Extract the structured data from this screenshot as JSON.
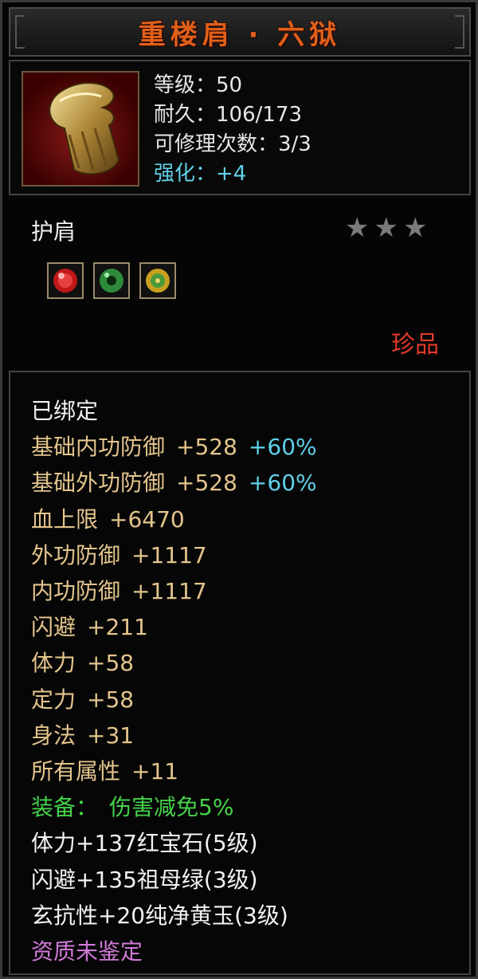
{
  "title": "重楼肩 · 六狱",
  "stats": {
    "level": "等级：50",
    "durability": "耐久：106/173",
    "repair": "可修理次数：3/3",
    "enhance": "强化：+4"
  },
  "item_type": "护肩",
  "star_count": 3,
  "gems": [
    "red-gem-icon",
    "green-jade-icon",
    "yellow-jade-icon"
  ],
  "rarity": "珍品",
  "attributes": {
    "bound": "已绑定",
    "base_inner": {
      "label": "基础内功防御",
      "value": "+528",
      "bonus": "+60%"
    },
    "base_outer": {
      "label": "基础外功防御",
      "value": "+528",
      "bonus": "+60%"
    },
    "hp": {
      "label": "血上限",
      "value": "+6470"
    },
    "outer_def": {
      "label": "外功防御",
      "value": "+1117"
    },
    "inner_def": {
      "label": "内功防御",
      "value": "+1117"
    },
    "dodge": {
      "label": "闪避",
      "value": "+211"
    },
    "vitality": {
      "label": "体力",
      "value": "+58"
    },
    "focus": {
      "label": "定力",
      "value": "+58"
    },
    "agility": {
      "label": "身法",
      "value": "+31"
    },
    "all_attr": {
      "label": "所有属性",
      "value": "+11"
    },
    "equip": {
      "label": "装备：",
      "value": "伤害减免5%"
    },
    "gem1": "体力+137红宝石(5级)",
    "gem2": "闪避+135祖母绿(3级)",
    "gem3": "玄抗性+20纯净黄玉(3级)",
    "quality": "资质未鉴定"
  },
  "colors": {
    "title": "#e0601a",
    "attribute": "#e3c48c",
    "bonus": "#5fd0e8",
    "set": "#46d24a",
    "rarity": "#e03a2a",
    "quality": "#d07ad8"
  }
}
